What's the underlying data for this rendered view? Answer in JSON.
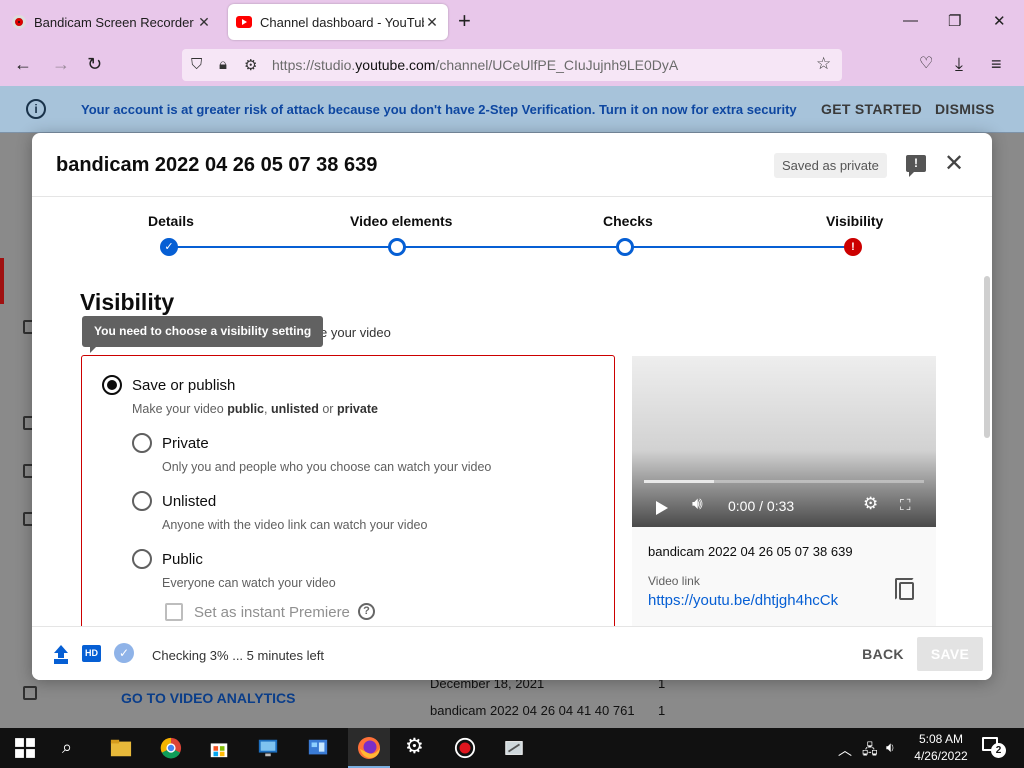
{
  "browser": {
    "tabs": [
      {
        "title": "Bandicam Screen Recorder Dow",
        "active": false
      },
      {
        "title": "Channel dashboard - YouTube S",
        "active": true
      }
    ],
    "url_prefix": "https://studio.",
    "url_domain": "youtube.com",
    "url_path": "/channel/UCeUlfPE_CIuJujnh9LE0DyA"
  },
  "banner": {
    "message": "Your account is at greater risk of attack because you don't have 2-Step Verification. Turn it on now for extra security",
    "get_started": "GET STARTED",
    "dismiss": "DISMISS"
  },
  "background": {
    "analytics_link": "GO TO VIDEO ANALYTICS",
    "rows": [
      {
        "title": "December 18, 2021",
        "count": "1"
      },
      {
        "title": "bandicam 2022 04 26 04 41 40 761",
        "count": "1"
      }
    ]
  },
  "modal": {
    "title": "bandicam 2022 04 26 05 07 38 639",
    "saved_chip": "Saved as private",
    "steps": [
      {
        "label": "Details",
        "state": "done"
      },
      {
        "label": "Video elements",
        "state": "current"
      },
      {
        "label": "Checks",
        "state": "current"
      },
      {
        "label": "Visibility",
        "state": "error"
      }
    ],
    "visibility": {
      "heading": "Visibility",
      "subtitle_visible": "e your video",
      "tooltip": "You need to choose a visibility setting",
      "save_or_publish": {
        "label": "Save or publish",
        "desc_1": "Make your video ",
        "desc_public": "public",
        "desc_2": ", ",
        "desc_unlisted": "unlisted",
        "desc_3": " or ",
        "desc_private": "private"
      },
      "options": [
        {
          "label": "Private",
          "desc": "Only you and people who you choose can watch your video"
        },
        {
          "label": "Unlisted",
          "desc": "Anyone with the video link can watch your video"
        },
        {
          "label": "Public",
          "desc": "Everyone can watch your video"
        }
      ],
      "premiere_label": "Set as instant Premiere"
    },
    "preview": {
      "time": "0:00 / 0:33",
      "progress_fraction": 0.25,
      "video_name": "bandicam 2022 04 26 05 07 38 639",
      "link_label": "Video link",
      "link": "https://youtu.be/dhtjgh4hcCk"
    },
    "footer": {
      "status": "Checking 3% ... 5 minutes left",
      "back": "BACK",
      "save": "SAVE",
      "hd_badge": "HD"
    }
  },
  "taskbar": {
    "time": "5:08 AM",
    "date": "4/26/2022",
    "notifications": "2"
  },
  "colors": {
    "accent_blue": "#065fd4",
    "error_red": "#cc0000",
    "browser_chrome": "#e8c7ea",
    "banner_bg": "#a7c3da"
  }
}
